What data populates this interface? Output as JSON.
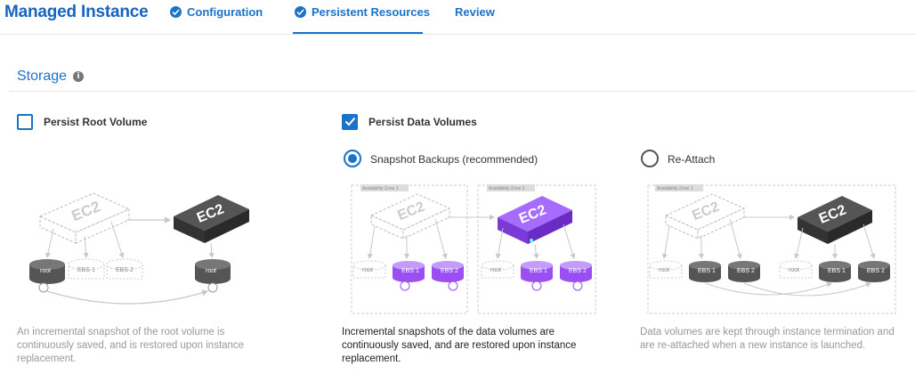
{
  "header": {
    "app_title": "Managed Instance",
    "steps": [
      {
        "label": "Configuration",
        "state": "complete"
      },
      {
        "label": "Persistent Resources",
        "state": "active"
      },
      {
        "label": "Review",
        "state": "pending"
      }
    ]
  },
  "storage": {
    "title": "Storage",
    "info_icon": "i",
    "root": {
      "label": "Persist Root Volume",
      "checked": false,
      "description": "An incremental snapshot of the root volume is continuously saved, and is restored upon instance replacement."
    },
    "data": {
      "label": "Persist Data Volumes",
      "checked": true,
      "options": [
        {
          "label": "Snapshot Backups (recommended)",
          "selected": true,
          "description": "Incremental snapshots of the data volumes are continuously saved, and are restored upon instance replacement."
        },
        {
          "label": "Re-Attach",
          "selected": false,
          "description": "Data volumes are kept through instance termination and are re-attached when a new instance is launched."
        }
      ]
    }
  },
  "diagram": {
    "ec2_label": "EC2",
    "az_label": "Availability Zone 1",
    "az2_label": "Availability Zone 2",
    "root_label": "root",
    "ebs1_label": "EBS 1",
    "ebs2_label": "EBS 2"
  },
  "colors": {
    "primary": "#1a73c8",
    "title": "#1565c0",
    "purple": "#9b4ff0",
    "dark_instance": "#3d3d3d",
    "muted_text": "#999999"
  }
}
